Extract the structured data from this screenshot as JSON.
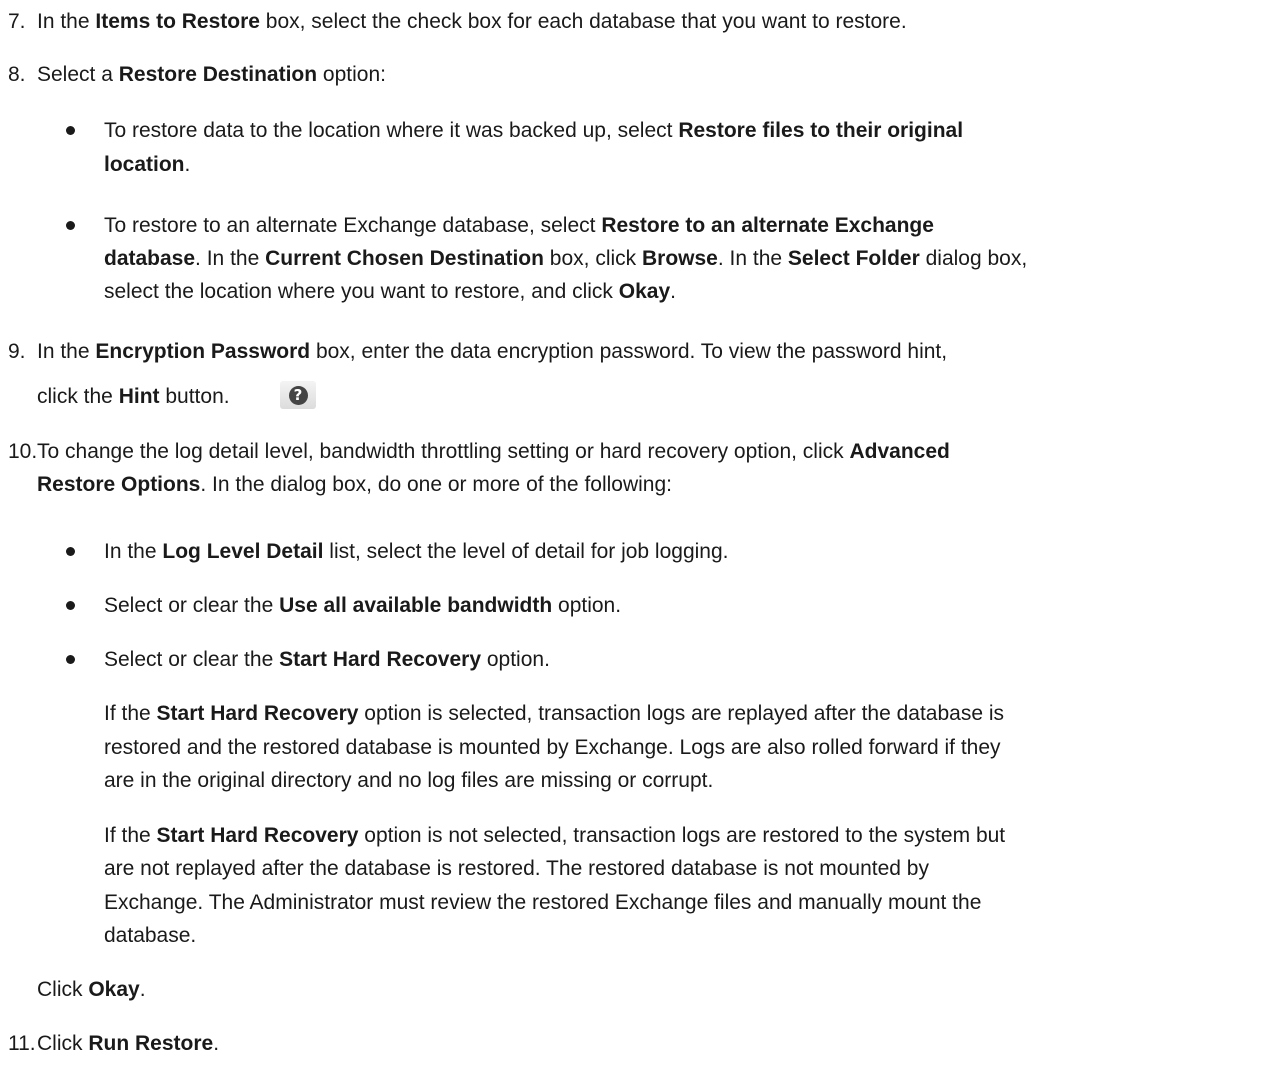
{
  "steps": {
    "s7": {
      "num": "7.",
      "t1": "In the ",
      "b1": "Items to Restore",
      "t2": " box, select the check box for each database that you want to restore."
    },
    "s8": {
      "num": "8.",
      "t1": "Select a ",
      "b1": "Restore Destination",
      "t2": " option:",
      "bullet1": {
        "l1_t1": "To restore data to the location where it was backed up, select ",
        "l1_b1": "Restore files to their original",
        "l2_b1": "location",
        "l2_t1": "."
      },
      "bullet2": {
        "l1_t1": "To restore to an alternate Exchange database, select ",
        "l1_b1": "Restore to an alternate Exchange",
        "l2_b1": "database",
        "l2_t1": ". In the ",
        "l2_b2": "Current Chosen Destination",
        "l2_t2": " box, click ",
        "l2_b3": "Browse",
        "l2_t3": ". In the ",
        "l2_b4": "Select Folder",
        "l2_t4": " dialog box,",
        "l3_t1": "select the location where you want to restore, and click ",
        "l3_b1": "Okay",
        "l3_t2": "."
      }
    },
    "s9": {
      "num": "9.",
      "l1_t1": "In the ",
      "l1_b1": "Encryption Password",
      "l1_t2": " box, enter the data encryption password. To view the password hint,",
      "l2_t1": "click the ",
      "l2_b1": "Hint",
      "l2_t2": " button.",
      "icon": "help-question-icon"
    },
    "s10": {
      "num": "10.",
      "l1_t1": "To change the log detail level, bandwidth throttling setting or hard recovery option, click ",
      "l1_b1": "Advanced",
      "l2_b1": "Restore Options",
      "l2_t1": ". In the dialog box, do one or more of the following:",
      "bullet1": {
        "t1": "In the ",
        "b1": "Log Level Detail",
        "t2": " list, select the level of detail for job logging."
      },
      "bullet2": {
        "t1": "Select or clear the ",
        "b1": "Use all available bandwidth",
        "t2": " option."
      },
      "bullet3": {
        "t1": "Select or clear the ",
        "b1": "Start Hard Recovery",
        "t2": " option."
      },
      "para1": {
        "l1_t1": "If the ",
        "l1_b1": "Start Hard Recovery",
        "l1_t2": " option is selected, transaction logs are replayed after the database is",
        "l2": "restored and the restored database is mounted by Exchange. Logs are also rolled forward if they",
        "l3": "are in the original directory and no log files are missing or corrupt."
      },
      "para2": {
        "l1_t1": "If the ",
        "l1_b1": "Start Hard Recovery",
        "l1_t2": " option is not selected, transaction logs are restored to the system but",
        "l2": "are not replayed after the database is restored. The restored database is not mounted by",
        "l3": "Exchange. The Administrator must review the restored Exchange files and manually mount the",
        "l4": "database."
      },
      "click_t1": "Click ",
      "click_b1": "Okay",
      "click_t2": "."
    },
    "s11": {
      "num": "11.",
      "t1": "Click ",
      "b1": "Run Restore",
      "t2": "."
    }
  }
}
